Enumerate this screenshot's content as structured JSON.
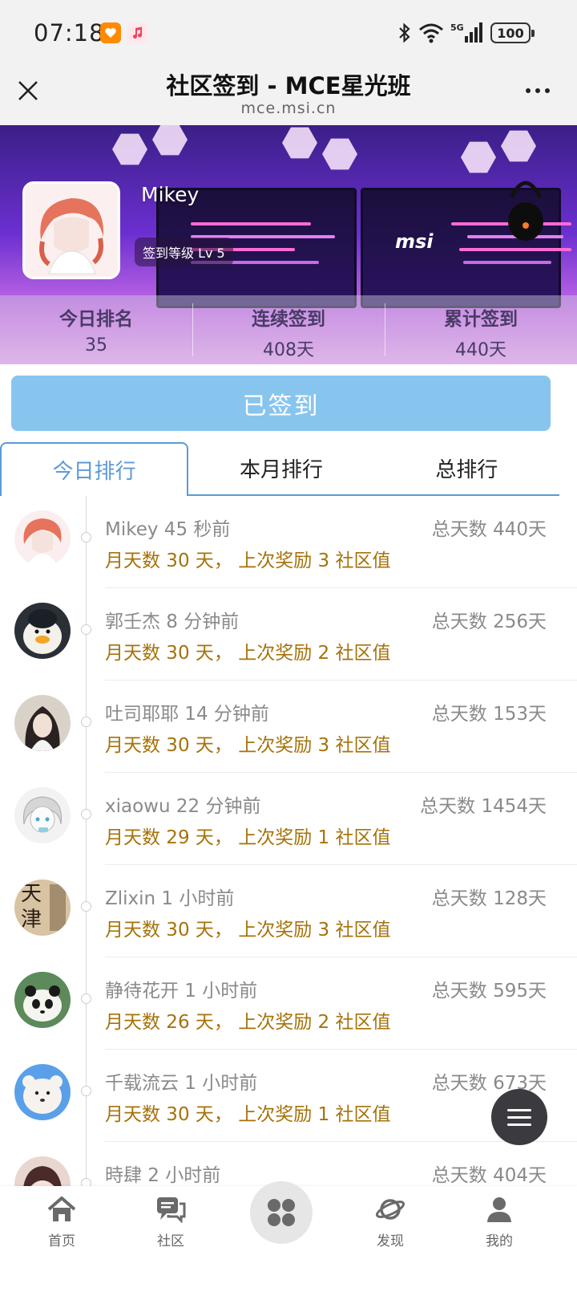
{
  "status_bar": {
    "time": "07:18",
    "battery": "100"
  },
  "titlebar": {
    "title": "社区签到 - MCE星光班",
    "url": "mce.msi.cn"
  },
  "banner": {
    "username": "Mikey",
    "level": "签到等级 Lv 5",
    "brand": "msi",
    "stats": [
      {
        "label": "今日排名",
        "value": "35"
      },
      {
        "label": "连续签到",
        "value": "408天"
      },
      {
        "label": "累计签到",
        "value": "440天"
      }
    ]
  },
  "signed_button": "已签到",
  "tabs": [
    {
      "label": "今日排行",
      "active": true
    },
    {
      "label": "本月排行",
      "active": false
    },
    {
      "label": "总排行",
      "active": false
    }
  ],
  "list": [
    {
      "name_time": "Mikey 45 秒前",
      "total": "总天数 440天",
      "detail": "月天数 30 天， 上次奖励 3 社区值"
    },
    {
      "name_time": "郭壬杰 8 分钟前",
      "total": "总天数 256天",
      "detail": "月天数 30 天， 上次奖励 2 社区值"
    },
    {
      "name_time": "吐司耶耶 14 分钟前",
      "total": "总天数 153天",
      "detail": "月天数 30 天， 上次奖励 3 社区值"
    },
    {
      "name_time": "xiaowu 22 分钟前",
      "total": "总天数 1454天",
      "detail": "月天数 29 天， 上次奖励 1 社区值"
    },
    {
      "name_time": "Zlixin 1 小时前",
      "total": "总天数 128天",
      "detail": "月天数 30 天， 上次奖励 3 社区值"
    },
    {
      "name_time": "静待花开 1 小时前",
      "total": "总天数 595天",
      "detail": "月天数 26 天， 上次奖励 2 社区值"
    },
    {
      "name_time": "千载流云 1 小时前",
      "total": "总天数 673天",
      "detail": "月天数 30 天， 上次奖励 1 社区值"
    },
    {
      "name_time": "時肆 2 小时前",
      "total": "总天数 404天",
      "detail": ""
    }
  ],
  "avatar_5_text": "天津",
  "bottom_nav": [
    {
      "label": "首页",
      "icon": "home-icon"
    },
    {
      "label": "社区",
      "icon": "chat-icon"
    },
    {
      "label": "",
      "icon": "apps-icon"
    },
    {
      "label": "发现",
      "icon": "planet-icon"
    },
    {
      "label": "我的",
      "icon": "user-icon"
    }
  ],
  "colors": {
    "accent": "#5b9ad7",
    "signed": "#87c5ee",
    "gold": "#a6720a"
  }
}
